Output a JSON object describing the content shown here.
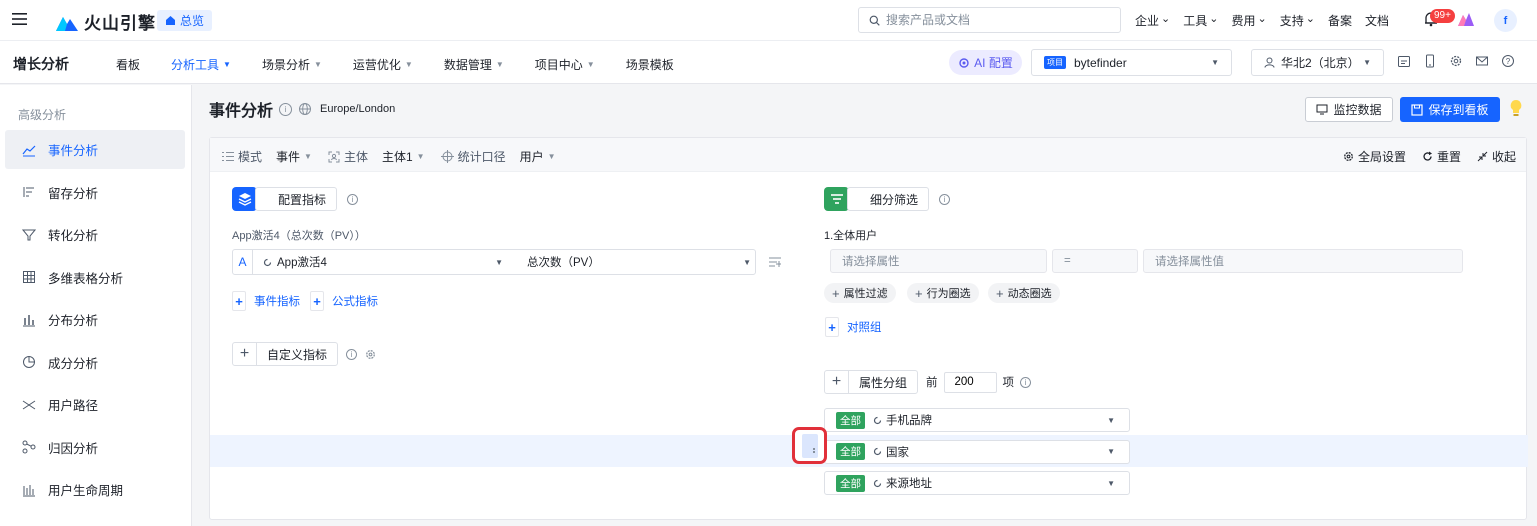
{
  "topbar": {
    "logo_text": "火山引擎",
    "overview_label": "总览",
    "search_placeholder": "搜索产品或文档",
    "nav": [
      {
        "label": "企业",
        "caret": true
      },
      {
        "label": "工具",
        "caret": true
      },
      {
        "label": "费用",
        "caret": true
      },
      {
        "label": "支持",
        "caret": true
      },
      {
        "label": "备案",
        "caret": false
      },
      {
        "label": "文档",
        "caret": false
      }
    ],
    "notification_badge": "99+",
    "user_avatar": "f"
  },
  "subbar": {
    "product_title": "增长分析",
    "nav": [
      {
        "label": "看板",
        "caret": false,
        "active": false
      },
      {
        "label": "分析工具",
        "caret": true,
        "active": true
      },
      {
        "label": "场景分析",
        "caret": true,
        "active": false
      },
      {
        "label": "运营优化",
        "caret": true,
        "active": false
      },
      {
        "label": "数据管理",
        "caret": true,
        "active": false
      },
      {
        "label": "项目中心",
        "caret": true,
        "active": false
      },
      {
        "label": "场景模板",
        "caret": false,
        "active": false
      }
    ],
    "ai_button": "AI 配置",
    "project_tag": "项目",
    "project_name": "bytefinder",
    "region": "华北2（北京）"
  },
  "sidebar": {
    "section_title": "高级分析",
    "items": [
      {
        "label": "事件分析",
        "icon": "line-chart-icon",
        "active": true
      },
      {
        "label": "留存分析",
        "icon": "retention-icon",
        "active": false
      },
      {
        "label": "转化分析",
        "icon": "funnel-icon",
        "active": false
      },
      {
        "label": "多维表格分析",
        "icon": "table-icon",
        "active": false
      },
      {
        "label": "分布分析",
        "icon": "bar-chart-icon",
        "active": false
      },
      {
        "label": "成分分析",
        "icon": "pie-chart-icon",
        "active": false
      },
      {
        "label": "用户路径",
        "icon": "path-icon",
        "active": false
      },
      {
        "label": "归因分析",
        "icon": "attribution-icon",
        "active": false
      },
      {
        "label": "用户生命周期",
        "icon": "lifecycle-icon",
        "active": false
      }
    ]
  },
  "page": {
    "title": "事件分析",
    "timezone": "Europe/London",
    "monitor_button": "监控数据",
    "save_button": "保存到看板"
  },
  "config_bar": {
    "mode_label": "模式",
    "mode_value": "事件",
    "subject_label": "主体",
    "subject_value": "主体1",
    "stat_label": "统计口径",
    "stat_value": "用户",
    "global_settings": "全局设置",
    "reset": "重置",
    "collapse": "收起"
  },
  "metrics": {
    "header_button": "配置指标",
    "metric_title": "App激活4（总次数（PV））",
    "metric_letter": "A",
    "event_name": "App激活4",
    "aggregation": "总次数（PV）",
    "add_event_metric": "事件指标",
    "add_formula_metric": "公式指标",
    "custom_metric": "自定义指标"
  },
  "filters": {
    "header_button": "细分筛选",
    "group_title": "1.全体用户",
    "property_placeholder": "请选择属性",
    "operator": "=",
    "value_placeholder": "请选择属性值",
    "chips": [
      "属性过滤",
      "行为圈选",
      "动态圈选"
    ],
    "compare_group": "对照组",
    "group_by_button": "属性分组",
    "top_prefix": "前",
    "top_value": "200",
    "top_suffix": "项",
    "group_rows": [
      {
        "tag": "全部",
        "name": "手机品牌"
      },
      {
        "tag": "全部",
        "name": "国家"
      },
      {
        "tag": "全部",
        "name": "来源地址"
      }
    ]
  }
}
